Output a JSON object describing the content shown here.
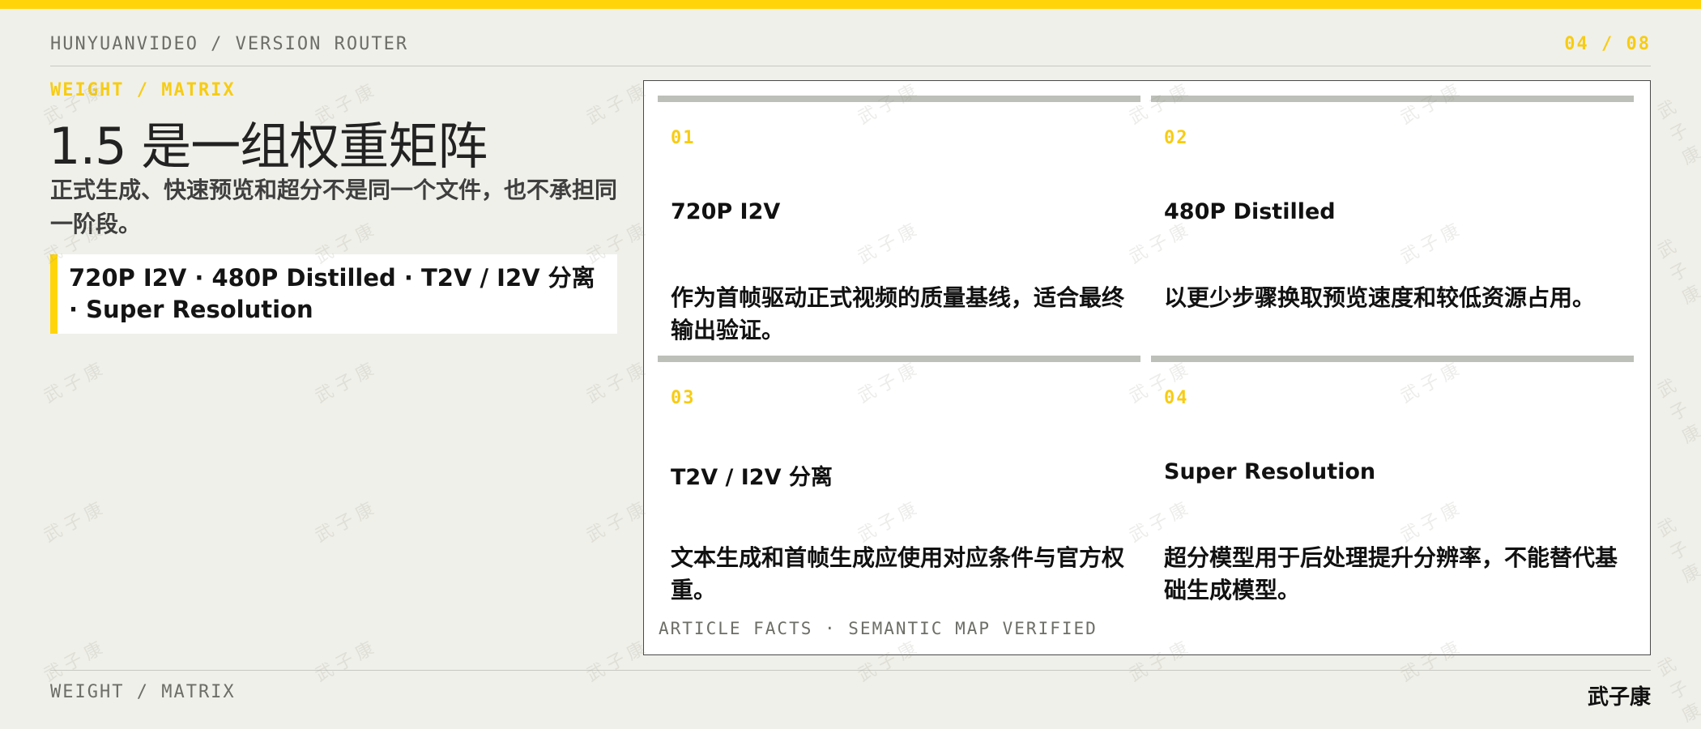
{
  "header": {
    "title": "HUNYUANVIDEO / VERSION ROUTER",
    "page": "04 / 08"
  },
  "eyebrow": "WEIGHT / MATRIX",
  "title": "1.5 是一组权重矩阵",
  "subtitle": "正式生成、快速预览和超分不是同一个文件，也不承担同一阶段。",
  "tagline": "720P I2V · 480P Distilled · T2V / I2V 分离 · Super Resolution",
  "cards": [
    {
      "num": "01",
      "title": "720P I2V",
      "desc": "作为首帧驱动正式视频的质量基线，适合最终输出验证。"
    },
    {
      "num": "02",
      "title": "480P Distilled",
      "desc": "以更少步骤换取预览速度和较低资源占用。"
    },
    {
      "num": "03",
      "title": "T2V / I2V 分离",
      "desc": "文本生成和首帧生成应使用对应条件与官方权重。"
    },
    {
      "num": "04",
      "title": "Super Resolution",
      "desc": "超分模型用于后处理提升分辨率，不能替代基础生成模型。"
    }
  ],
  "panel_footer": "ARTICLE FACTS · SEMANTIC MAP VERIFIED",
  "footer": {
    "left": "WEIGHT / MATRIX",
    "right": "武子康"
  },
  "watermark": "武子康",
  "colors": {
    "accent": "#ffd50a",
    "background": "#f0f0ea",
    "panel": "#ffffff",
    "card_bar": "#bcc0b8"
  }
}
